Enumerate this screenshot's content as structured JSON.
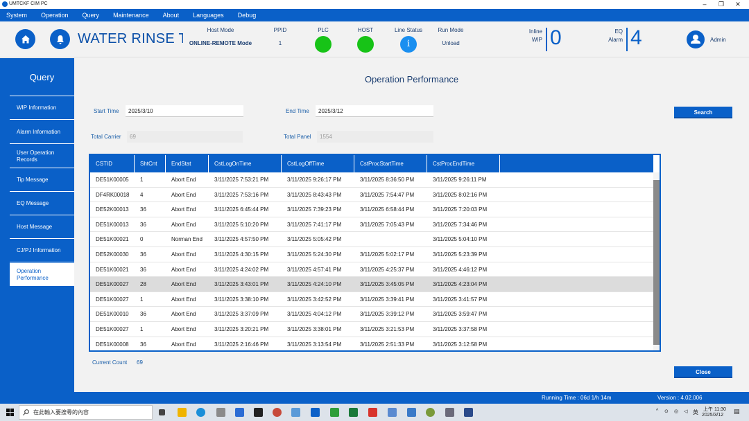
{
  "window": {
    "title": "UMTCKF CIM PC"
  },
  "menu": [
    "System",
    "Operation",
    "Query",
    "Maintenance",
    "About",
    "Languages",
    "Debug"
  ],
  "header": {
    "app_title": "WATER RINSE TR",
    "host_mode_label": "Host Mode",
    "host_mode_value": "ONLINE-REMOTE Mode",
    "ppid_label": "PPID",
    "ppid_value": "1",
    "plc_label": "PLC",
    "host_label": "HOST",
    "line_status_label": "Line Status",
    "line_status_icon": "i",
    "run_mode_label": "Run Mode",
    "run_mode_value": "Unload",
    "wip_label_1": "Inline",
    "wip_label_2": "WIP",
    "wip_value": "0",
    "alarm_label_1": "EQ",
    "alarm_label_2": "Alarm",
    "alarm_value": "4",
    "user_name": "Admin",
    "colors": {
      "plc": "#17c317",
      "host": "#17c317",
      "line_status": "#1a8ff0"
    }
  },
  "sidebar": {
    "title": "Query",
    "items": [
      {
        "label": "WIP Information"
      },
      {
        "label": "Alarm Information"
      },
      {
        "label": "User Operation Records"
      },
      {
        "label": "Tip Message"
      },
      {
        "label": "EQ Message"
      },
      {
        "label": "Host Message"
      },
      {
        "label": "CJ/PJ Information"
      },
      {
        "label": "Operation Performance"
      }
    ]
  },
  "main": {
    "title": "Operation Performance",
    "start_time_label": "Start Time",
    "start_time_value": "2025/3/10",
    "end_time_label": "End Time",
    "end_time_value": "2025/3/12",
    "total_carrier_label": "Total Carrier",
    "total_carrier_value": "69",
    "total_panel_label": "Total Panel",
    "total_panel_value": "1554",
    "search_label": "Search",
    "close_label": "Close",
    "current_count_label": "Current Count",
    "current_count_value": "69",
    "columns": [
      "CSTID",
      "ShtCnt",
      "EndStat",
      "CstLogOnTime",
      "CstLogOffTime",
      "CstProcStartTime",
      "CstProcEndTime"
    ],
    "rows": [
      [
        "DE51K00005",
        "1",
        "Abort End",
        "3/11/2025 7:53:21 PM",
        "3/11/2025 9:26:17 PM",
        "3/11/2025 8:36:50 PM",
        "3/11/2025 9:26:11 PM"
      ],
      [
        "DF4RK00018",
        "4",
        "Abort End",
        "3/11/2025 7:53:16 PM",
        "3/11/2025 8:43:43 PM",
        "3/11/2025 7:54:47 PM",
        "3/11/2025 8:02:16 PM"
      ],
      [
        "DE52K00013",
        "36",
        "Abort End",
        "3/11/2025 6:45:44 PM",
        "3/11/2025 7:39:23 PM",
        "3/11/2025 6:58:44 PM",
        "3/11/2025 7:20:03 PM"
      ],
      [
        "DE51K00013",
        "36",
        "Abort End",
        "3/11/2025 5:10:20 PM",
        "3/11/2025 7:41:17 PM",
        "3/11/2025 7:05:43 PM",
        "3/11/2025 7:34:46 PM"
      ],
      [
        "DE51K00021",
        "0",
        "Norman End",
        "3/11/2025 4:57:50 PM",
        "3/11/2025 5:05:42 PM",
        "",
        "3/11/2025 5:04:10 PM"
      ],
      [
        "DE52K00030",
        "36",
        "Abort End",
        "3/11/2025 4:30:15 PM",
        "3/11/2025 5:24:30 PM",
        "3/11/2025 5:02:17 PM",
        "3/11/2025 5:23:39 PM"
      ],
      [
        "DE51K00021",
        "36",
        "Abort End",
        "3/11/2025 4:24:02 PM",
        "3/11/2025 4:57:41 PM",
        "3/11/2025 4:25:37 PM",
        "3/11/2025 4:46:12 PM"
      ],
      [
        "DE51K00027",
        "28",
        "Abort End",
        "3/11/2025 3:43:01 PM",
        "3/11/2025 4:24:10 PM",
        "3/11/2025 3:45:05 PM",
        "3/11/2025 4:23:04 PM"
      ],
      [
        "DE51K00027",
        "1",
        "Abort End",
        "3/11/2025 3:38:10 PM",
        "3/11/2025 3:42:52 PM",
        "3/11/2025 3:39:41 PM",
        "3/11/2025 3:41:57 PM"
      ],
      [
        "DE51K00010",
        "36",
        "Abort End",
        "3/11/2025 3:37:09 PM",
        "3/11/2025 4:04:12 PM",
        "3/11/2025 3:39:12 PM",
        "3/11/2025 3:59:47 PM"
      ],
      [
        "DE51K00027",
        "1",
        "Abort End",
        "3/11/2025 3:20:21 PM",
        "3/11/2025 3:38:01 PM",
        "3/11/2025 3:21:53 PM",
        "3/11/2025 3:37:58 PM"
      ],
      [
        "DE51K00008",
        "36",
        "Abort End",
        "3/11/2025 2:16:46 PM",
        "3/11/2025 3:13:54 PM",
        "3/11/2025 2:51:33 PM",
        "3/11/2025 3:12:58 PM"
      ]
    ]
  },
  "statusbar": {
    "running_time": "Running Time :  06d 1/h 14m",
    "version": "Version :  4.02.006"
  },
  "taskbar": {
    "search_placeholder": "在此輸入要搜尋的內容",
    "tray_lang": "英",
    "clock_time": "上午 11:30",
    "clock_date": "2025/3/12"
  }
}
